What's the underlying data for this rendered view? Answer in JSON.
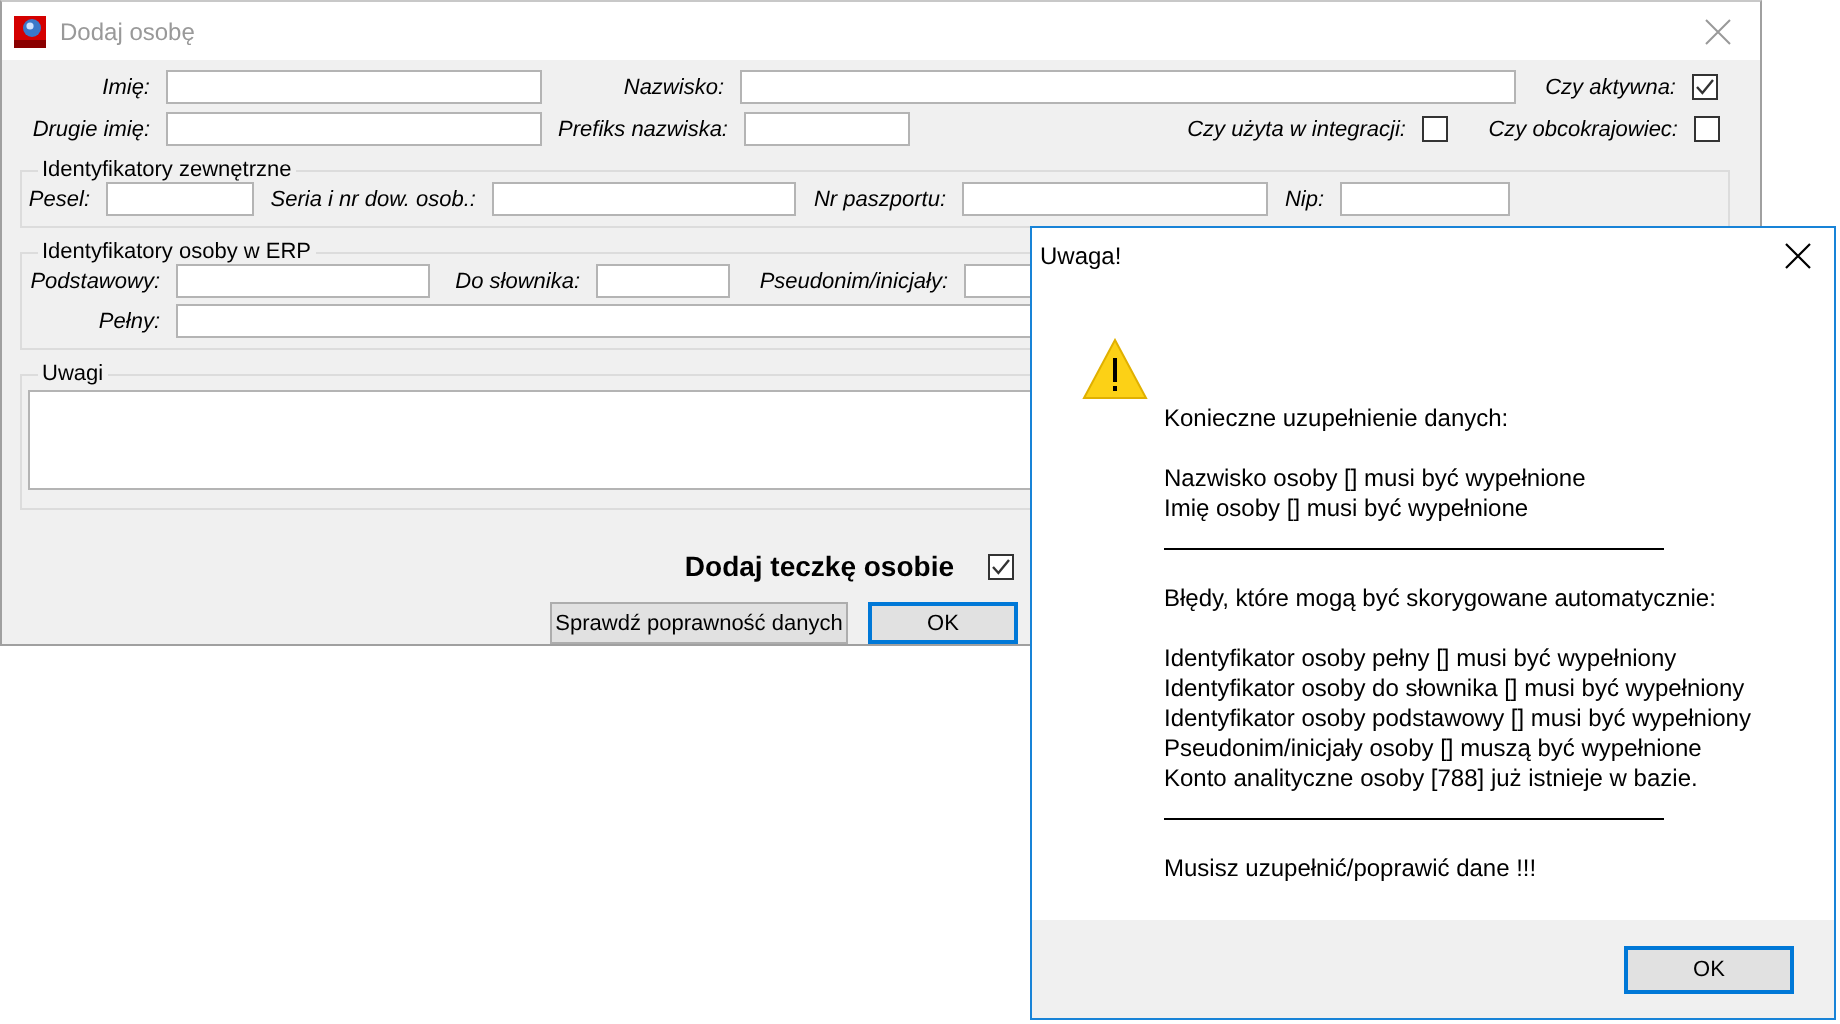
{
  "main_window": {
    "title": "Dodaj osobę",
    "rows": [
      [
        {
          "kind": "field",
          "label": "Imię:"
        },
        {
          "kind": "field",
          "label": "Nazwisko:"
        },
        "",
        {
          "kind": "checkbox",
          "label": "Czy aktywna:",
          "checked": true
        }
      ],
      [
        {
          "kind": "field",
          "label": "Drugie imię:"
        },
        {
          "kind": "field",
          "label": "Prefiks nazwiska:"
        },
        {
          "kind": "checkbox",
          "label": "Czy użyta w integracji:",
          "checked": false
        },
        {
          "kind": "checkbox",
          "label": "Czy obcokrajowiec:",
          "checked": false
        }
      ]
    ],
    "groups": [
      {
        "title": "Identyfikatory zewnętrzne",
        "rows": [
          [
            {
              "kind": "field",
              "label": "Pesel:"
            },
            {
              "kind": "field",
              "label": "Seria i nr dow. osob.:"
            },
            {
              "kind": "field",
              "label": "Nr paszportu:"
            },
            {
              "kind": "field",
              "label": "Nip:"
            }
          ]
        ]
      },
      {
        "title": "Identyfikatory osoby w ERP",
        "rows": [
          [
            {
              "kind": "field",
              "label": "Podstawowy:"
            },
            {
              "kind": "field",
              "label": "Do słownika:"
            },
            {
              "kind": "field",
              "label": "Pseudonim/inicjały:"
            }
          ],
          [
            {
              "kind": "field",
              "label": "Pełny:"
            }
          ]
        ]
      },
      {
        "title": "Uwagi",
        "rows": [
          [
            {
              "kind": "textarea"
            }
          ]
        ]
      }
    ],
    "folder_option": {
      "label": "Dodaj teczkę osobie",
      "checked": true
    },
    "buttons": [
      {
        "label": "Sprawdź poprawność danych",
        "default": false
      },
      {
        "label": "OK",
        "default": true
      }
    ]
  },
  "dialog": {
    "title": "Uwaga!",
    "message": [
      {
        "kind": "paragraph",
        "lines": [
          "Konieczne uzupełnienie danych:"
        ]
      },
      {
        "kind": "paragraph",
        "lines": [
          "Nazwisko osoby [] musi być wypełnione",
          "Imię osoby [] musi być wypełnione"
        ]
      },
      {
        "kind": "rule"
      },
      {
        "kind": "paragraph",
        "lines": [
          "Błędy, które mogą być skorygowane automatycznie:"
        ]
      },
      {
        "kind": "paragraph",
        "lines": [
          "Identyfikator osoby pełny [] musi być wypełniony",
          "Identyfikator osoby do słownika [] musi być wypełniony",
          "Identyfikator osoby podstawowy [] musi być wypełniony",
          "Pseudonim/inicjały osoby [] muszą być wypełnione",
          "Konto analityczne osoby [788] już istnieje w bazie."
        ]
      },
      {
        "kind": "rule"
      },
      {
        "kind": "paragraph",
        "lines": [
          "Musisz uzupełnić/poprawić dane !!!"
        ]
      }
    ],
    "buttons": [
      {
        "label": "OK",
        "default": true
      }
    ]
  }
}
